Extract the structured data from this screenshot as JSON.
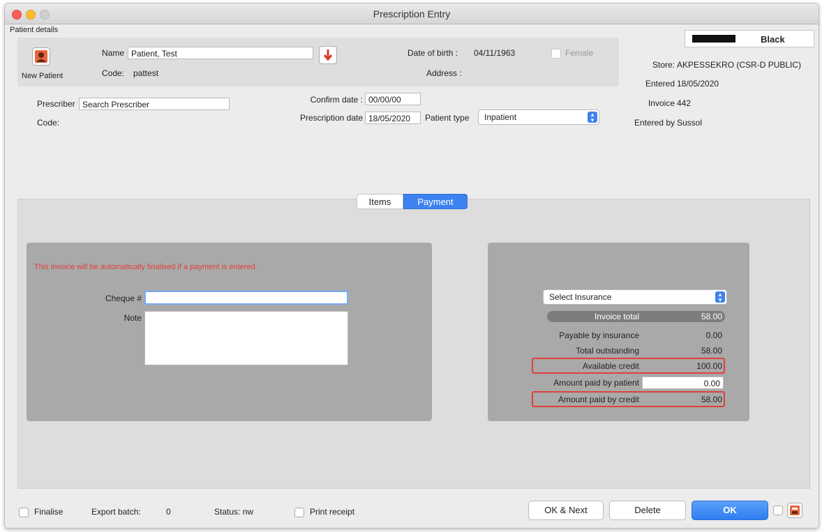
{
  "window": {
    "title": "Prescription Entry"
  },
  "patient": {
    "section_label": "Patient details",
    "new_patient_label": "New Patient",
    "name_label": "Name",
    "name_value": "Patient, Test",
    "code_label": "Code:",
    "code_value": "pattest",
    "dob_label": "Date of birth :",
    "dob_value": "04/11/1963",
    "female_label": "Female",
    "address_label": "Address :"
  },
  "store_info": {
    "color_name": "Black",
    "store_label": "Store:",
    "store_value": "AKPESSEKRO (CSR-D PUBLIC)",
    "entered_label": "Entered",
    "entered_value": "18/05/2020",
    "invoice_label": "Invoice",
    "invoice_value": "442",
    "entered_by_label": "Entered by",
    "entered_by_value": "Sussol"
  },
  "prescriber": {
    "label": "Prescriber",
    "placeholder": "Search Prescriber",
    "code_label": "Code:"
  },
  "dates": {
    "confirm_label": "Confirm date :",
    "confirm_value": "00/00/00",
    "prescription_label": "Prescription date",
    "prescription_value": "18/05/2020",
    "patient_type_label": "Patient type",
    "patient_type_value": "Inpatient"
  },
  "tabs": [
    {
      "label": "Items",
      "active": false
    },
    {
      "label": "Payment",
      "active": true
    }
  ],
  "payment": {
    "warning": "This invoice will be automatically finalised if a payment is entered.",
    "cheque_label": "Cheque #",
    "cheque_value": "",
    "note_label": "Note",
    "note_value": ""
  },
  "summary": {
    "insurance_select": "Select Insurance",
    "invoice_total_label": "Invoice total",
    "invoice_total_value": "58.00",
    "payable_insurance_label": "Payable by insurance",
    "payable_insurance_value": "0.00",
    "total_outstanding_label": "Total outstanding",
    "total_outstanding_value": "58.00",
    "available_credit_label": "Available credit",
    "available_credit_value": "100.00",
    "paid_patient_label": "Amount paid by patient",
    "paid_patient_value": "0.00",
    "paid_credit_label": "Amount paid by credit",
    "paid_credit_value": "58.00"
  },
  "footer": {
    "finalise_label": "Finalise",
    "export_batch_label": "Export batch:",
    "export_batch_value": "0",
    "status_label": "Status: nw",
    "print_receipt_label": "Print receipt",
    "ok_next_label": "OK & Next",
    "delete_label": "Delete",
    "ok_label": "OK"
  },
  "colors": {
    "accent": "#3c82f0",
    "warning": "#e0403a",
    "panel": "#a9a9a9"
  }
}
